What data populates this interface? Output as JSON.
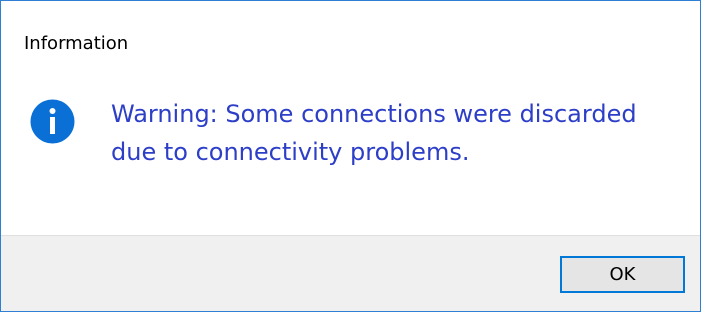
{
  "window": {
    "title": "Information"
  },
  "message": {
    "icon": "info-icon",
    "text": "Warning: Some connections were discarded due to connectivity problems."
  },
  "buttons": {
    "ok_label": "OK"
  },
  "colors": {
    "message_text": "#2d3ec7",
    "icon_fill": "#0a70d6",
    "button_border": "#0078d7",
    "footer_background": "#f0f0f0"
  }
}
